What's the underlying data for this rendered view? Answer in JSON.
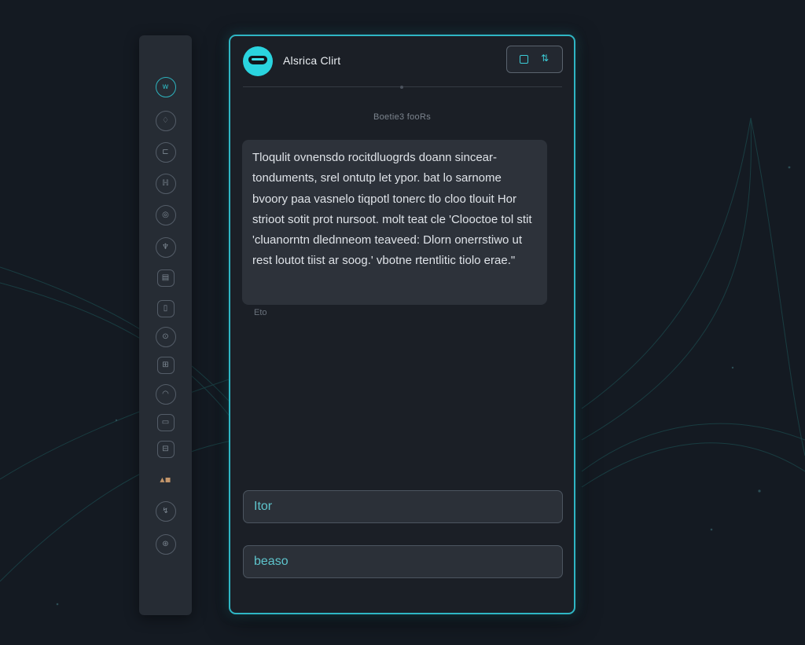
{
  "app": {
    "title": "Alsrica Clirt"
  },
  "header": {
    "toggle_glyph": "⇅"
  },
  "conversation": {
    "timestamp": "Boetie3 fooRs",
    "message": "Tloqulit ovnensdo rocitdluogrds doann sincear-tonduments, srel ontutp let ypor. bat lo sarnome bvoory paa vasnelo tiqpotl tonerc tlo cloo tlouit Hor strioot sotit prot nursoot. molt teat cle 'Clooctoe tol stit 'cluanorntn dlednneom teaveed: Dlorn onerrstiwo ut rest loutot tiist ar soog.' vbotne rtentlitic tiolo erae.\"",
    "meta": "Eto"
  },
  "inputs": {
    "first": "Itor",
    "second": "beaso"
  },
  "rail": {
    "items": [
      {
        "glyph": "w",
        "icon": "home-icon"
      },
      {
        "glyph": "♢",
        "icon": "shapes-icon"
      },
      {
        "glyph": "⊏",
        "icon": "layers-icon"
      },
      {
        "glyph": "ℍ",
        "icon": "text-icon"
      },
      {
        "glyph": "◎",
        "icon": "target-icon"
      },
      {
        "glyph": "♆",
        "icon": "anchor-icon"
      },
      {
        "glyph": "▤",
        "icon": "list-icon"
      },
      {
        "glyph": "▯",
        "icon": "document-icon"
      },
      {
        "glyph": "⊙",
        "icon": "settings-icon"
      },
      {
        "glyph": "⊞",
        "icon": "grid-icon"
      },
      {
        "glyph": "◠",
        "icon": "cloud-icon"
      },
      {
        "glyph": "▭",
        "icon": "window-icon"
      },
      {
        "glyph": "⊟",
        "icon": "database-icon"
      },
      {
        "glyph": "▴▪",
        "icon": "alert-icon"
      },
      {
        "glyph": "↯",
        "icon": "bolt-icon"
      },
      {
        "glyph": "⊛",
        "icon": "profile-icon"
      }
    ]
  },
  "colors": {
    "accent": "#2fb6c4",
    "background": "#141a22",
    "panel": "#1b1f26",
    "bubble": "#2d323a"
  }
}
